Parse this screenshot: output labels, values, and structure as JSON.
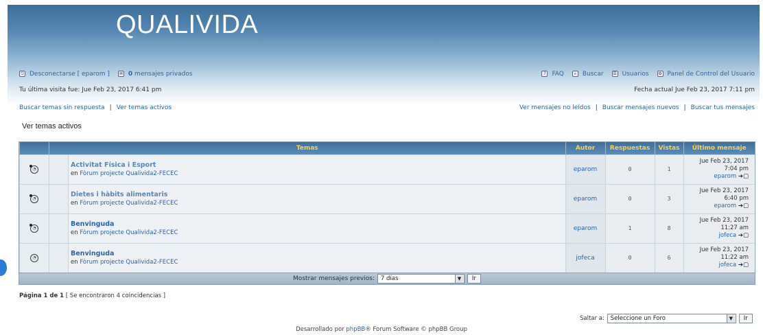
{
  "site": {
    "title": "QUALIVIDA"
  },
  "user_bar": {
    "logout": "Desconectarse [ eparom ]",
    "pm_count": "0",
    "pm_label": " mensajes privados",
    "faq": "FAQ",
    "search": "Buscar",
    "members": "Usuarios",
    "ucp": "Panel de Control del Usuario"
  },
  "visit": {
    "last_visit": "Tu última visita fue: Jue Feb 23, 2017 6:41 pm",
    "current_date": "Fecha actual Jue Feb 23, 2017 7:11 pm"
  },
  "search_links": {
    "unanswered": "Buscar temas sin respuesta",
    "active": "Ver temas activos",
    "unread": "Ver mensajes no leídos",
    "new_posts": "Buscar mensajes nuevos",
    "own_posts": "Buscar tus mensajes"
  },
  "page_heading": "Ver temas activos",
  "table": {
    "headers": {
      "topics": "Temas",
      "author": "Autor",
      "replies": "Respuestas",
      "views": "Vistas",
      "last_post": "Último mensaje"
    },
    "rows": [
      {
        "title": "Activitat Física i Esport",
        "forum_prefix": "en ",
        "forum": "Fòrum projecte Qualivida2-FECEC",
        "author": "eparom",
        "replies": "0",
        "views": "1",
        "last_date": "Jue Feb 23, 2017",
        "last_time": "7:04 pm",
        "last_author": "eparom",
        "icon": "topic-read-posted-icon"
      },
      {
        "title": "Dietes i hàbits alimentaris",
        "forum_prefix": "en ",
        "forum": "Fòrum projecte Qualivida2-FECEC",
        "author": "eparom",
        "replies": "0",
        "views": "3",
        "last_date": "Jue Feb 23, 2017",
        "last_time": "6:40 pm",
        "last_author": "eparom",
        "icon": "topic-read-posted-icon"
      },
      {
        "title": "Benvinguda",
        "forum_prefix": "en ",
        "forum": "Fòrum projecte Qualivida2-FECEC",
        "author": "eparom",
        "replies": "1",
        "views": "8",
        "last_date": "Jue Feb 23, 2017",
        "last_time": "11:27 am",
        "last_author": "jofeca",
        "icon": "topic-read-posted-icon"
      },
      {
        "title": "Benvinguda",
        "forum_prefix": "en ",
        "forum": "Fòrum projecte Qualivida2-FECEC",
        "author": "jofeca",
        "replies": "0",
        "views": "6",
        "last_date": "Jue Feb 23, 2017",
        "last_time": "11:22 am",
        "last_author": "jofeca",
        "icon": "topic-read-icon"
      }
    ],
    "footer": {
      "label": "Mostrar mensajes previos:",
      "select_value": "7 días",
      "button": "Ir"
    }
  },
  "pagination": {
    "page_text": "Página 1 de 1",
    "matches": "[ Se encontraron 4 coincidencias ]"
  },
  "jumpbox": {
    "label": "Saltar a:",
    "select_value": "Seleccione un Foro",
    "button": "Ir"
  },
  "footer": {
    "prefix": "Desarrollado por ",
    "link": "phpBB",
    "suffix": "® Forum Software © phpBB Group"
  },
  "colors": {
    "header_top": "#3c6e9a",
    "table_head": "#4a7ca8",
    "head_text": "#ffd23f",
    "link": "#2c64a8"
  }
}
